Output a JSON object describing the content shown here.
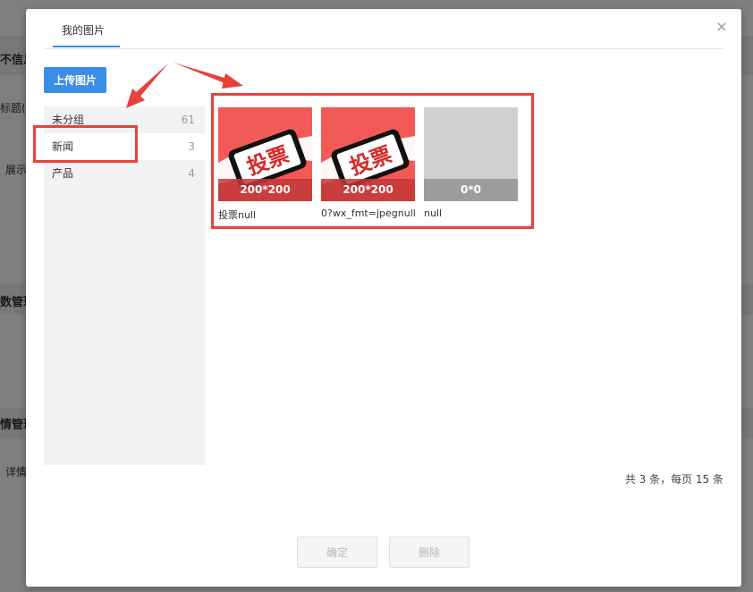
{
  "background": {
    "fragments": [
      "不信息",
      "标题(",
      "展示",
      "数管理",
      "情管理",
      "详情"
    ]
  },
  "modal": {
    "tab_label": "我的图片",
    "close_label": "×",
    "upload_label": "上传图片",
    "groups": [
      {
        "name": "未分组",
        "count": "61"
      },
      {
        "name": "新闻",
        "count": "3"
      },
      {
        "name": "产品",
        "count": "4"
      }
    ],
    "active_group_index": 1,
    "images": [
      {
        "label": "投票null",
        "dims": "200*200",
        "badge": "投票"
      },
      {
        "label": "0?wx_fmt=jpegnull",
        "dims": "200*200",
        "badge": "投票"
      },
      {
        "label": "null",
        "dims": "0*0",
        "badge": ""
      }
    ],
    "pagination_text": "共 3 条，每页 15 条",
    "confirm_label": "确定",
    "delete_label": "删除"
  },
  "colors": {
    "accent": "#3a8ee6",
    "annotation": "#e8413c",
    "vote_red": "#f35a57"
  },
  "icons": {
    "close": "close-icon",
    "vote_badge": "vote-phone-icon"
  }
}
